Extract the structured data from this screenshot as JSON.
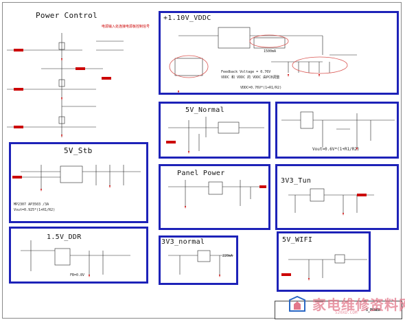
{
  "blocks": {
    "power_control": {
      "title": "Power Control",
      "note_cn": "电源输入处连接电源板控制信号"
    },
    "vddc": {
      "title": "+1.10V_VDDC",
      "current": "1500mA",
      "feedback": "Feedback Voltage = 0.76V",
      "footnote": "VDDC 和 VDDC 的 VDDC 由PCB调整",
      "rail_label": "VDDC=0.76V*(1+R1/R2)"
    },
    "five_v_normal": {
      "title": "5V_Normal"
    },
    "vout_block": {
      "formula": "Vout=0.6V*(1+R1/R2)"
    },
    "five_v_stb": {
      "title": "5V_Stb",
      "ic_note": "MP2307 AP3503 /3A",
      "formula": "Vout=0.925*(1+R1/R2)"
    },
    "panel_power": {
      "title": "Panel Power"
    },
    "tun": {
      "title": "3V3_Tun"
    },
    "ddr": {
      "title": "1.5V_DDR",
      "fb": "FB=0.8V"
    },
    "three_v3": {
      "title": "3V3_normal",
      "current": "220mA"
    },
    "wifi": {
      "title": "5V_WIFI"
    }
  },
  "title_block": {
    "sheet_name": "5_POWER"
  },
  "watermark": {
    "text": "家电维修资料网",
    "site": "520XD.COM"
  },
  "colors": {
    "block_border": "#1d22b8",
    "net_red": "#cc0000",
    "highlight": "#d9534f",
    "watermark": "#e2788a"
  }
}
